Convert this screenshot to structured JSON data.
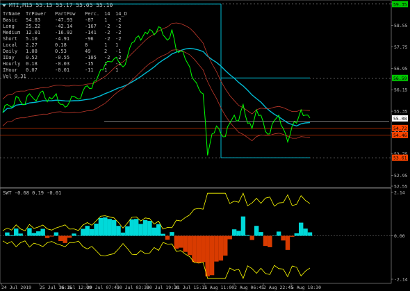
{
  "header": {
    "symbol_line": "MTI,M15  55.15 55.17 55.05 55.10",
    "indicator_line": "SWT -0.68 0.19 -0.01"
  },
  "colors": {
    "background": "#000000",
    "axis": "#c0c0c0",
    "price": "#00ff00",
    "ma_cyan": "#00bcd4",
    "ma_red": "#c0392b",
    "ma_orange": "#cc3300",
    "level_line": "#c0c0c0",
    "hist_cyan": "#00ffff",
    "hist_orange": "#ff4500",
    "hist_yellow": "#ffff00",
    "label_green_bg": "#00c800",
    "label_orange_bg": "#ff4500",
    "label_white_bg": "#ffffff"
  },
  "info_table": {
    "headers": [
      "TrName",
      "TrPower",
      "PartPow",
      "Perc.",
      "14",
      "14_D"
    ],
    "rows": [
      [
        "Basic",
        "54.83",
        "-47.93",
        "-87",
        "1",
        "-2"
      ],
      [
        "Long",
        "25.22",
        "-42.14",
        "-167",
        "-2",
        "-2"
      ],
      [
        "Medium",
        "12.01",
        "-16.92",
        "-141",
        "-2",
        "-2"
      ],
      [
        "Short",
        "5.10",
        "-4.91",
        "-96",
        "-2",
        "-2"
      ],
      [
        "Local",
        "2.27",
        "0.18",
        "8",
        "1",
        "1"
      ],
      [
        "Daily",
        "1.08",
        "0.53",
        "49",
        "2",
        "-1"
      ],
      [
        "IDay",
        "0.52",
        "-0.55",
        "-105",
        "-2",
        "-2"
      ],
      [
        "Hourly",
        "0.18",
        "-0.03",
        "-15",
        "1",
        "-1"
      ],
      [
        "IHour",
        "0.07",
        "-0.01",
        "-11",
        "1",
        "1"
      ]
    ],
    "footer": "Vol 0.31"
  },
  "chart_data": [
    {
      "type": "line",
      "title": "MTI,M15",
      "ylim": [
        52.55,
        59.45
      ],
      "y_ticks": [
        "59.35",
        "58.55",
        "57.75",
        "56.95",
        "56.15",
        "55.35",
        "54.55",
        "53.75",
        "52.95",
        "52.55"
      ],
      "x_ticks": [
        "24 Jul 2019",
        "25 Jul 16:15",
        "26 Jul 12:00",
        "29 Jul 07:45",
        "30 Jul 03:30",
        "30 Jul 19:30",
        "31 Jul 15:15",
        "1 Aug 11:00",
        "2 Aug 06:45",
        "2 Aug 22:45",
        "5 Aug 18:30"
      ],
      "price_labels": [
        {
          "value": 59.35,
          "text": "59.35",
          "style": "green"
        },
        {
          "value": 56.59,
          "text": "56.59",
          "style": "green"
        },
        {
          "value": 55.08,
          "text": "55.08",
          "style": "white"
        },
        {
          "value": 54.72,
          "text": "54.72",
          "style": "orange"
        },
        {
          "value": 54.46,
          "text": "54.46",
          "style": "orange"
        },
        {
          "value": 53.61,
          "text": "53.61",
          "style": "orange"
        }
      ],
      "horizontal_levels": [
        54.72,
        54.46
      ],
      "series": [
        {
          "values": [
            55.3,
            55.6,
            55.5,
            55.9,
            55.7,
            55.6,
            56.0,
            55.8,
            55.9,
            56.1,
            55.7,
            55.8,
            56.0,
            55.6,
            55.5,
            55.7,
            55.9,
            55.8,
            56.1,
            56.3,
            56.2,
            56.5,
            56.9,
            57.1,
            57.2,
            57.3,
            57.2,
            57.0,
            57.4,
            57.9,
            58.1,
            58.0,
            58.3,
            58.4,
            58.2,
            58.5,
            58.2,
            58.0,
            58.4,
            57.6,
            57.6,
            57.3,
            57.0,
            56.5,
            56.2,
            56.0,
            53.7,
            54.5,
            54.8,
            54.5,
            54.4,
            54.9,
            55.2,
            55.0,
            55.6,
            54.9,
            54.7,
            55.4,
            55.2,
            54.6,
            54.5,
            55.0,
            55.2,
            54.7,
            54.2,
            54.8,
            54.9,
            55.4,
            55.2,
            55.1
          ]
        }
      ]
    },
    {
      "type": "area",
      "title": "SWT",
      "ylim": [
        -2.14,
        2.14
      ],
      "y_ticks": [
        "2.14",
        "0.00",
        "-2.14"
      ]
    }
  ]
}
